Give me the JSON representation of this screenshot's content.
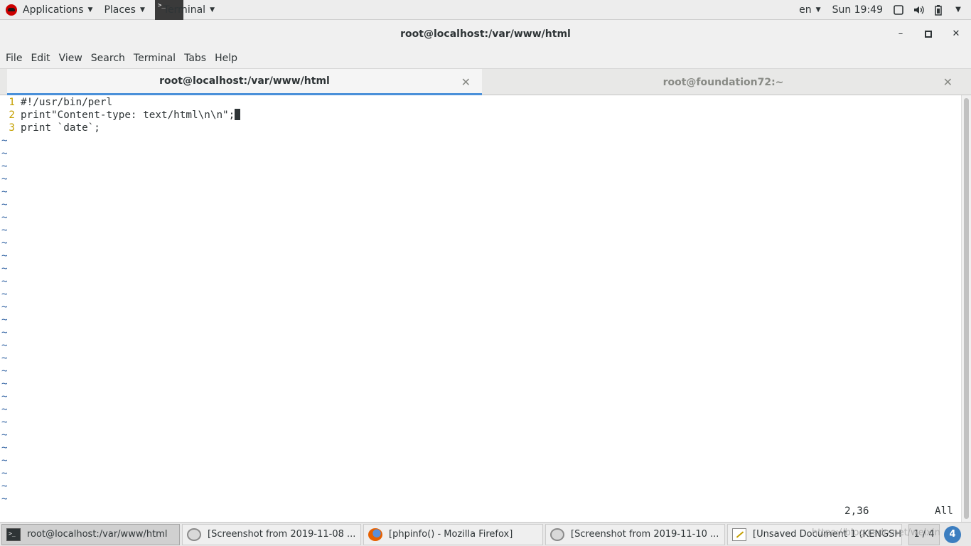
{
  "topbar": {
    "applications": "Applications",
    "places": "Places",
    "terminal": "Terminal",
    "language": "en",
    "clock": "Sun 19:49",
    "icons": [
      "display-icon",
      "volume-icon",
      "battery-icon",
      "power-menu-arrow-icon"
    ]
  },
  "window": {
    "title": "root@localhost:/var/www/html",
    "controls": {
      "minimize": "–",
      "maximize": "▫",
      "close": "✕"
    }
  },
  "menubar": {
    "items": [
      "File",
      "Edit",
      "View",
      "Search",
      "Terminal",
      "Tabs",
      "Help"
    ]
  },
  "tabs": [
    {
      "label": "root@localhost:/var/www/html",
      "active": true
    },
    {
      "label": "root@foundation72:~",
      "active": false
    }
  ],
  "editor": {
    "lines": [
      {
        "num": "1",
        "text": "#!/usr/bin/perl"
      },
      {
        "num": "2",
        "text": "print\"Content-type: text/html\\n\\n\";"
      },
      {
        "num": "3",
        "text": "print `date`;"
      }
    ],
    "tilde": "~",
    "ruler": "2,36",
    "position": "All"
  },
  "taskbar": {
    "items": [
      {
        "label": "root@localhost:/var/www/html",
        "icon": "terminal-icon",
        "active": true
      },
      {
        "label": "[Screenshot from 2019-11-08 ...",
        "icon": "screenshot-icon",
        "active": false
      },
      {
        "label": "[phpinfo() - Mozilla Firefox]",
        "icon": "firefox-icon",
        "active": false
      },
      {
        "label": "[Screenshot from 2019-11-10 ...",
        "icon": "screenshot-icon",
        "active": false
      },
      {
        "label": "[Unsaved Document 1 (KENGSH...",
        "icon": "text-editor-icon",
        "active": false
      }
    ],
    "workspace": "1 / 4",
    "notification_count": "4"
  },
  "watermark": "https://blog.csdn.net/weixin",
  "colors": {
    "line_number": "#c4a000",
    "tilde": "#3465a4",
    "tab_accent": "#4a90d9"
  }
}
